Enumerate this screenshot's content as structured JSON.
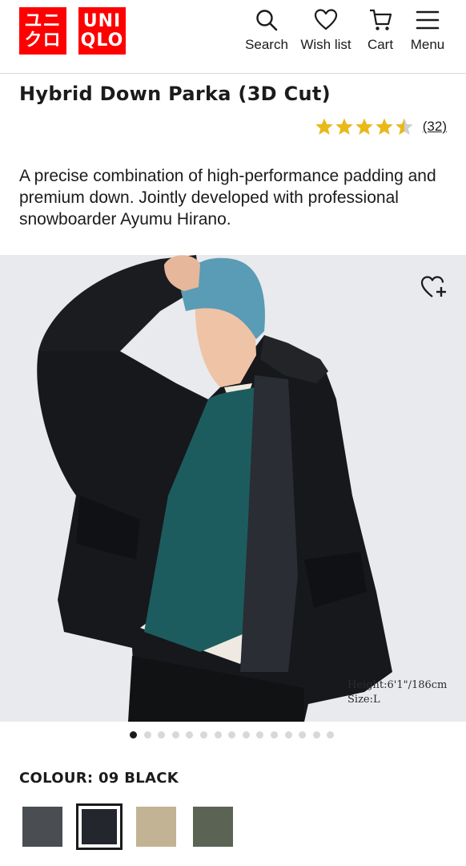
{
  "header": {
    "logo_top": [
      "ユニ",
      "クロ"
    ],
    "logo_bottom": [
      "UNI",
      "QLO"
    ],
    "nav": [
      {
        "label": "Search",
        "icon": "search-icon"
      },
      {
        "label": "Wish list",
        "icon": "heart-icon"
      },
      {
        "label": "Cart",
        "icon": "cart-icon"
      },
      {
        "label": "Menu",
        "icon": "hamburger-icon"
      }
    ]
  },
  "product": {
    "name": "Hybrid Down Parka (3D Cut)",
    "rating": 4.5,
    "review_count": "(32)",
    "description": "A precise combination of high-performance padding and premium down. Jointly developed with professional snowboarder Ayumu Hirano."
  },
  "gallery": {
    "model_height": "Height:6'1\"/186cm",
    "model_size": "Size:L",
    "image_count": 15,
    "active_index": 0
  },
  "colour": {
    "label": "COLOUR: 09 BLACK",
    "options": [
      {
        "name": "gray",
        "color": "#4a4d52"
      },
      {
        "name": "black",
        "color": "#23262c",
        "selected": true
      },
      {
        "name": "beige",
        "color": "#c2b394"
      },
      {
        "name": "olive",
        "color": "#5b6355"
      }
    ]
  },
  "colors": {
    "brand": "#ff0000",
    "star": "#e8b919",
    "text": "#1b1b1b"
  }
}
